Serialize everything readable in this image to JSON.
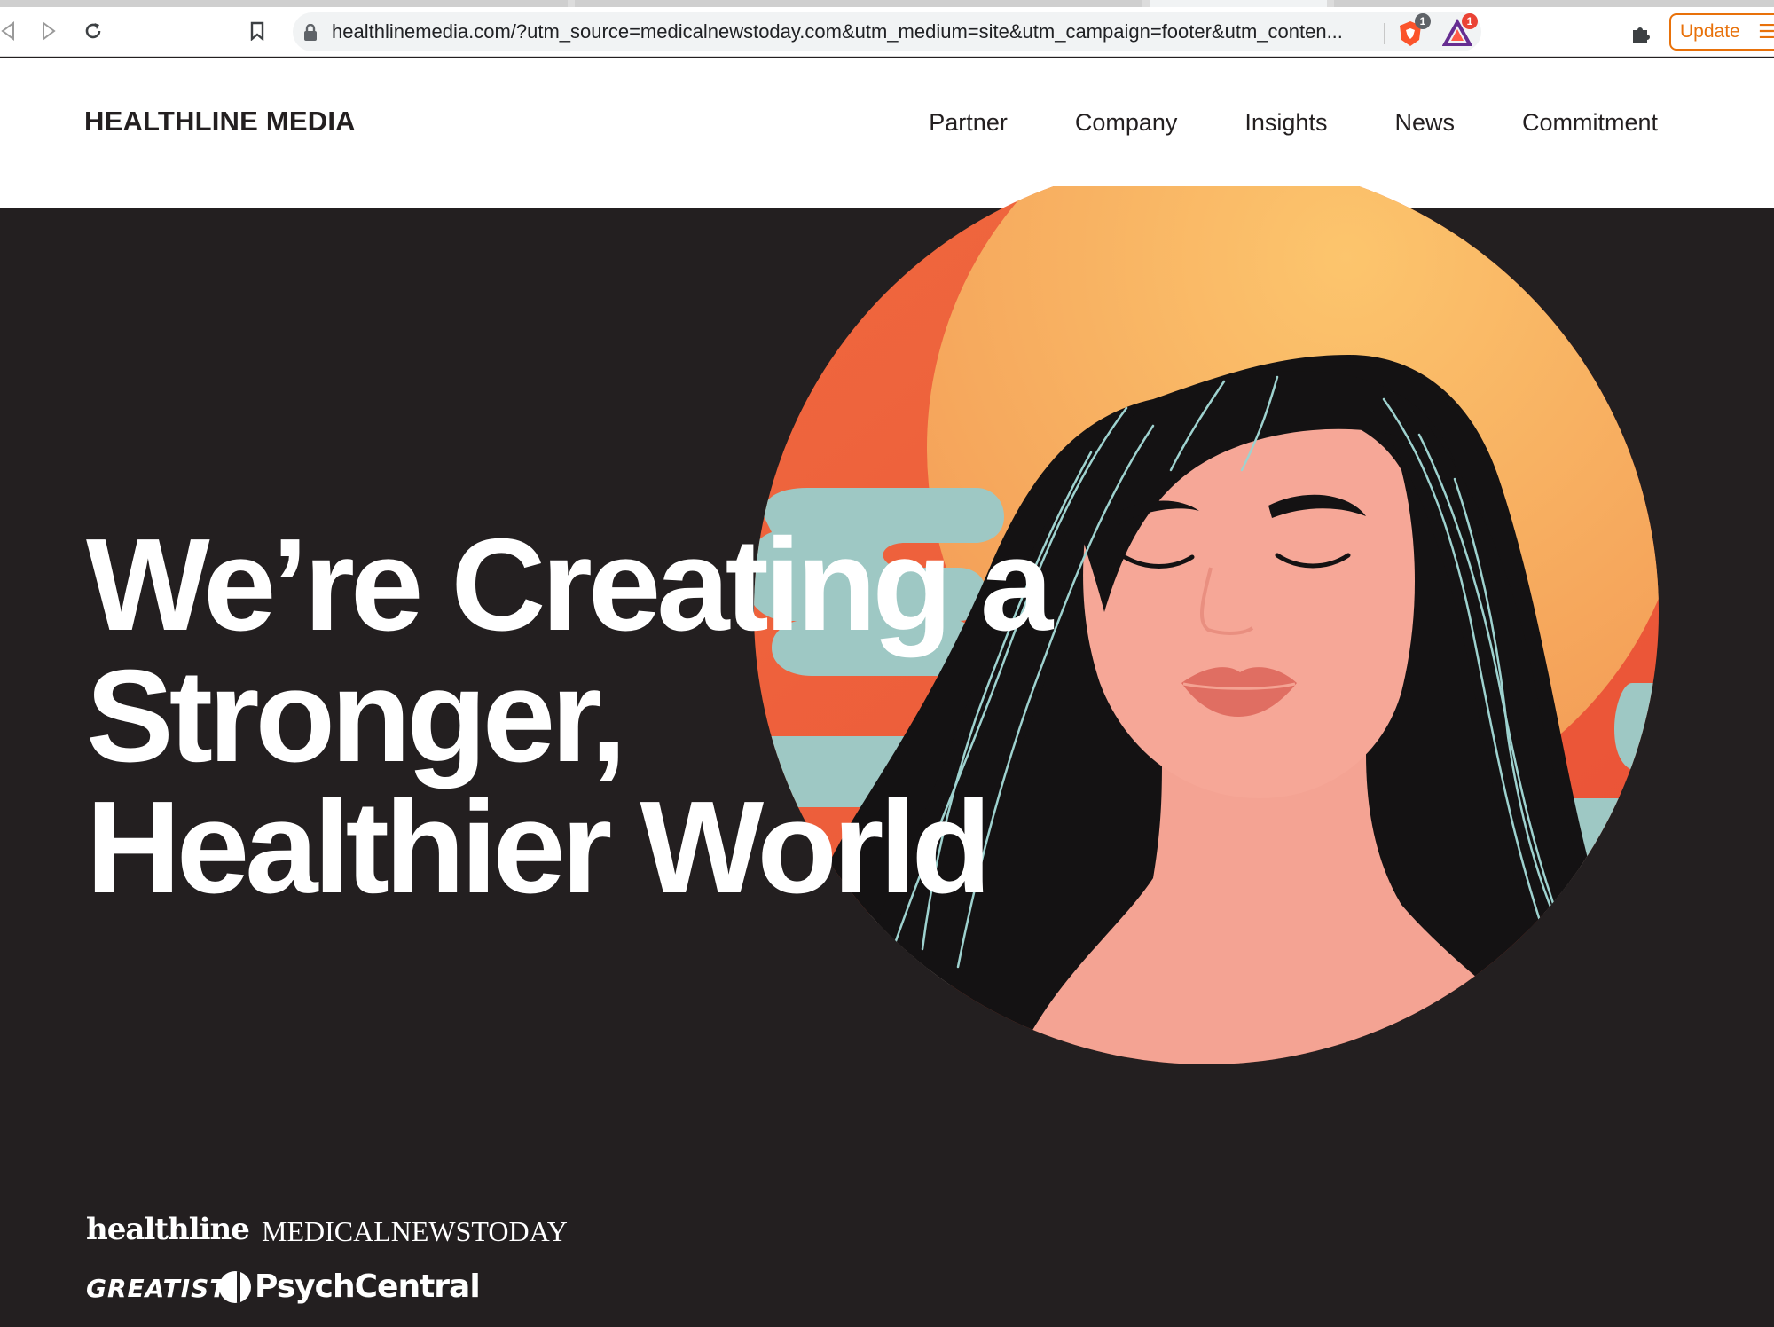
{
  "browser": {
    "url": "healthlinemedia.com/?utm_source=medicalnewstoday.com&utm_medium=site&utm_campaign=footer&utm_conten...",
    "update_label": "Update",
    "menu_glyph": "☰",
    "brave_badge": "1",
    "rewards_badge": "1",
    "icons": [
      "back-icon",
      "forward-icon",
      "reload-icon",
      "bookmark-icon",
      "lock-icon",
      "brave-shields-icon",
      "brave-rewards-icon",
      "extensions-icon"
    ]
  },
  "header": {
    "brand": "HEALTHLINE MEDIA",
    "nav": [
      "Partner",
      "Company",
      "Insights",
      "News",
      "Commitment"
    ]
  },
  "hero": {
    "headline_lines": [
      "We’re Creating a",
      "Stronger,",
      "Healthier World"
    ]
  },
  "brands": {
    "healthline": "healthline",
    "medical_news_today": "MEDICALNEWSTODAY",
    "greatist": "GREATIST",
    "psych_central": "PsychCentral"
  },
  "colors": {
    "background": "#231f20",
    "header_bg": "#ffffff",
    "orange_red": "#ef5a3f",
    "sun_orange": "#f7ad63",
    "cloud_teal": "#9ec8c4",
    "skin": "#f4a393",
    "hair": "#141213",
    "update_orange": "#e8710a"
  }
}
